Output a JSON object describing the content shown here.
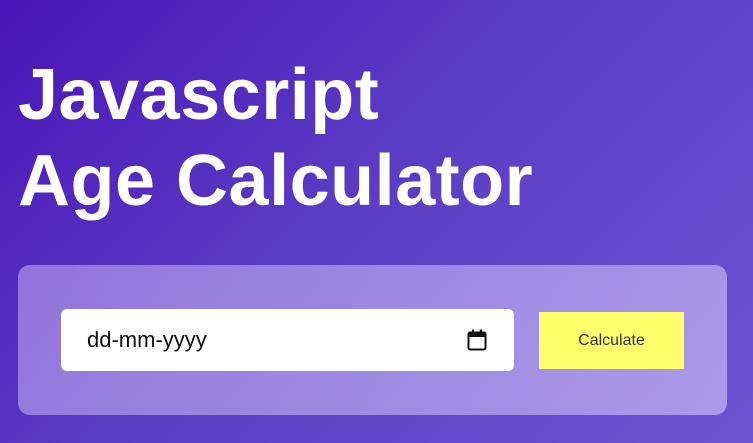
{
  "header": {
    "title_line1": "Javascript",
    "title_line2": "Age Calculator"
  },
  "form": {
    "date_input": {
      "placeholder": "dd-mm-yyyy",
      "value": ""
    },
    "calculate_label": "Calculate"
  },
  "icons": {
    "calendar": "calendar-icon"
  },
  "colors": {
    "background_start": "#4a14b8",
    "background_end": "#6c55d2",
    "button": "#ffff6b",
    "title_text": "#ffffff"
  }
}
